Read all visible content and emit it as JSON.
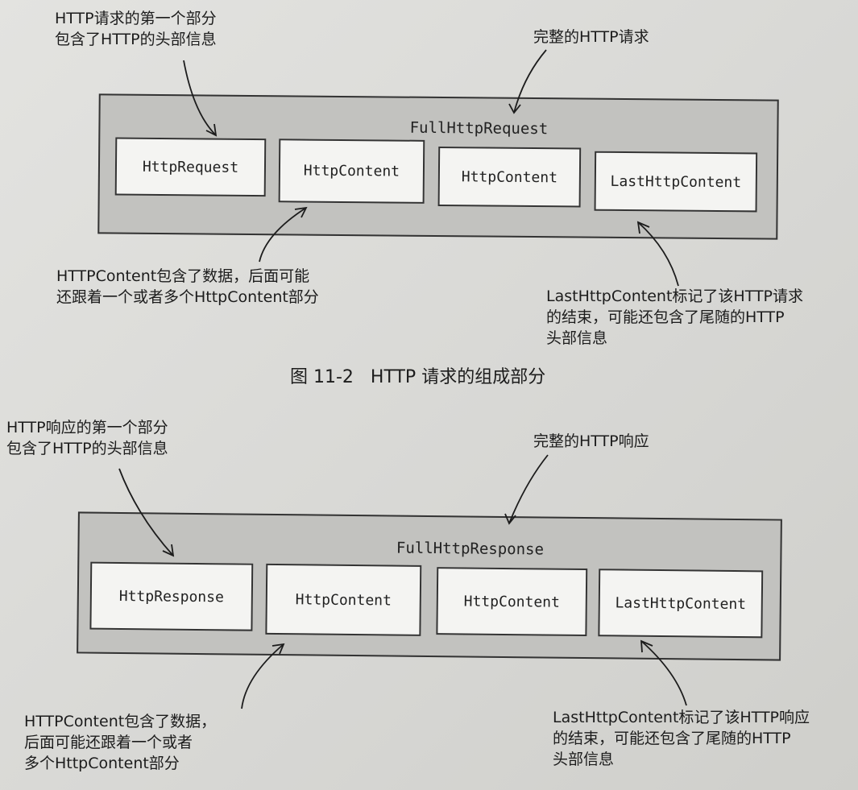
{
  "request_figure": {
    "container_label": "FullHttpRequest",
    "parts": [
      "HttpRequest",
      "HttpContent",
      "HttpContent",
      "LastHttpContent"
    ],
    "notes": {
      "first_part": "HTTP请求的第一个部分\n包含了HTTP的头部信息",
      "complete": "完整的HTTP请求",
      "content": "HTTPContent包含了数据，后面可能\n还跟着一个或者多个HttpContent部分",
      "last": "LastHttpContent标记了该HTTP请求\n的结束，可能还包含了尾随的HTTP\n头部信息"
    }
  },
  "caption": "图 11-2   HTTP 请求的组成部分",
  "response_figure": {
    "container_label": "FullHttpResponse",
    "parts": [
      "HttpResponse",
      "HttpContent",
      "HttpContent",
      "LastHttpContent"
    ],
    "notes": {
      "first_part": "HTTP响应的第一个部分\n包含了HTTP的头部信息",
      "complete": "完整的HTTP响应",
      "content": "HTTPContent包含了数据，\n后面可能还跟着一个或者\n多个HttpContent部分",
      "last": "LastHttpContent标记了该HTTP响应\n的结束，可能还包含了尾随的HTTP\n头部信息"
    }
  }
}
